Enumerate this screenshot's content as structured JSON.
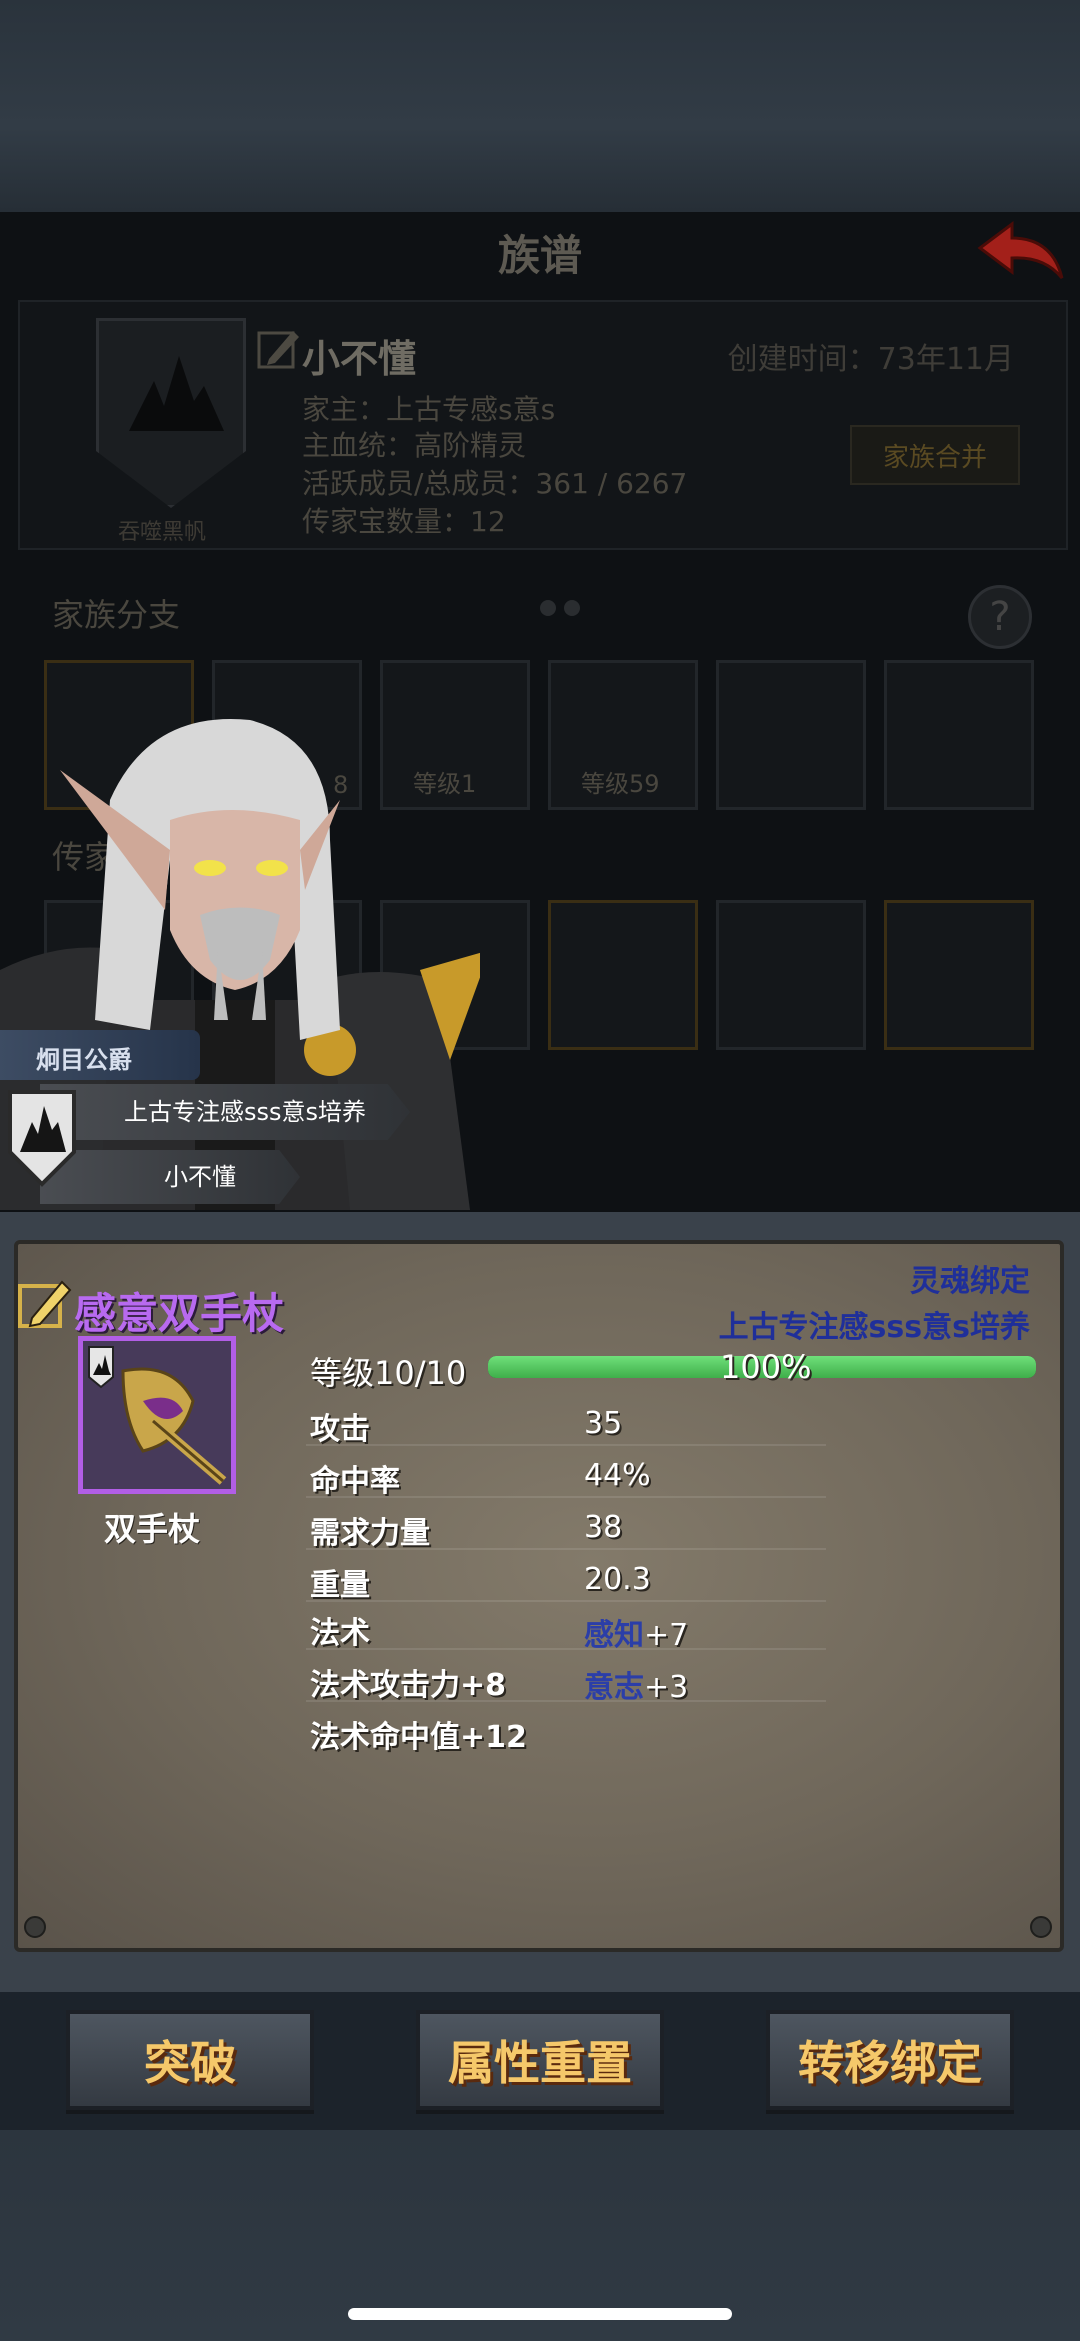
{
  "family": {
    "title": "族谱",
    "name": "小不懂",
    "created": "创建时间：73年11月",
    "patriarch": "家主：上古专感s意s",
    "bloodline": "主血统：高阶精灵",
    "members": "活跃成员/总成员：361 / 6267",
    "heirlooms": "传家宝数量：12",
    "crest_name": "吞噬黑帆",
    "merge_button": "家族合并",
    "branch_label": "家族分支",
    "legacy_label": "传家宝",
    "slots": [
      {
        "level": ""
      },
      {
        "level": "8"
      },
      {
        "level": "等级1"
      },
      {
        "level": "等级59"
      },
      {
        "level": ""
      },
      {
        "level": ""
      }
    ]
  },
  "character": {
    "title": "炯目公爵",
    "family": "上古专注感sss意s培养",
    "name": "小不懂"
  },
  "item": {
    "name": "感意双手杖",
    "binding": "灵魂绑定",
    "owner": "上古专注感sss意s培养",
    "type": "双手杖",
    "level_label": "等级10/10",
    "level_progress": 100,
    "level_pct": "100%",
    "stats": [
      {
        "label": "攻击",
        "value": "35"
      },
      {
        "label": "命中率",
        "value": "44%"
      },
      {
        "label": "需求力量",
        "value": "38"
      },
      {
        "label": "重量",
        "value": "20.3"
      },
      {
        "label": "法术",
        "value_name": "感知",
        "value_num": "+7"
      },
      {
        "label": "法术攻击力+8",
        "value_name": "意志",
        "value_num": "+3"
      },
      {
        "label": "法术命中值+12",
        "value": ""
      }
    ]
  },
  "buttons": {
    "breakthrough": "突破",
    "reset": "属性重置",
    "transfer": "转移绑定"
  },
  "colors": {
    "item_name": "#b86af0",
    "binding_text": "#1f2f9a",
    "button_text": "#f5c86a",
    "level_bar": "#4fc85a"
  },
  "icons": [
    "back-arrow-icon",
    "edit-pen-icon",
    "help-icon",
    "family-crest-icon",
    "staff-icon"
  ]
}
